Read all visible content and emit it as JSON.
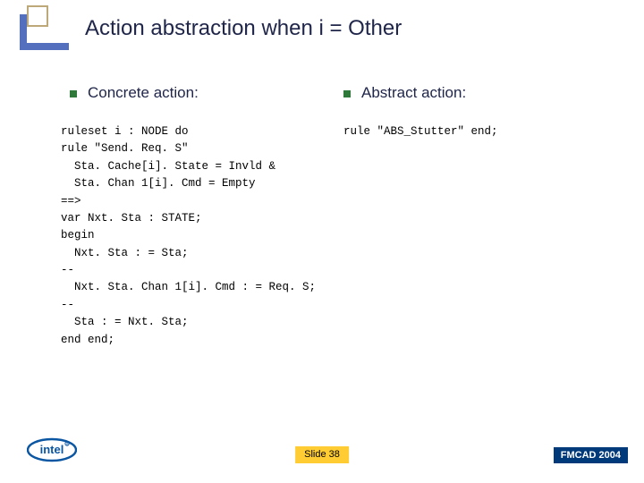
{
  "slide": {
    "title": "Action abstraction when i = Other",
    "left": {
      "heading": "Concrete action:",
      "code": "ruleset i : NODE do\nrule \"Send. Req. S\"\n  Sta. Cache[i]. State = Invld &\n  Sta. Chan 1[i]. Cmd = Empty\n==>\nvar Nxt. Sta : STATE;\nbegin\n  Nxt. Sta : = Sta;\n--\n  Nxt. Sta. Chan 1[i]. Cmd : = Req. S;\n--\n  Sta : = Nxt. Sta;\nend end;"
    },
    "right": {
      "heading": "Abstract action:",
      "code": "rule \"ABS_Stutter\" end;"
    },
    "footer": {
      "slide_label": "Slide 38",
      "brand": "intel",
      "conference": "FMCAD 2004"
    }
  }
}
